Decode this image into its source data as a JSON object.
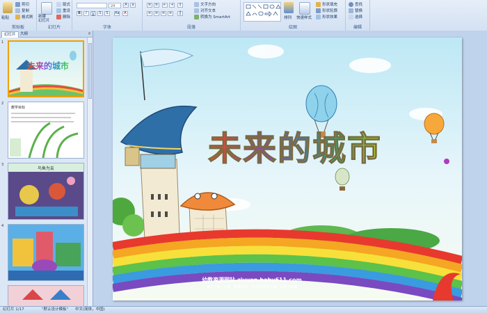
{
  "ribbon": {
    "groups": {
      "clipboard": "剪贴板",
      "slides": "幻灯片",
      "font": "字体",
      "paragraph": "段落",
      "drawing": "绘图",
      "editing": "编辑"
    },
    "paste": "粘贴",
    "cut": "剪切",
    "copy": "复制",
    "format_painter": "格式刷",
    "new_slide": "新建\n幻灯片",
    "layout": "版式",
    "reset": "重设",
    "delete": "删除",
    "font_size": "24",
    "text_direction": "文字方向",
    "align_text": "对齐文本",
    "convert_smartart": "转换为 SmartArt",
    "arrange": "排列",
    "quick_styles": "快速样式",
    "shape_fill": "形状填充",
    "shape_outline": "形状轮廓",
    "shape_effects": "形状效果",
    "find": "查找",
    "replace": "替换",
    "select": "选择"
  },
  "panel": {
    "tab_slides": "幻灯片",
    "tab_outline": "大纲",
    "close": "×",
    "thumbs": [
      {
        "num": "1",
        "title": "未来的城市"
      },
      {
        "num": "2",
        "title": "教学目标"
      },
      {
        "num": "3",
        "title": "鸟鱼为友"
      },
      {
        "num": "4",
        "title": ""
      }
    ]
  },
  "slide": {
    "title": "未来的城市",
    "footer_line1": "幼教资源网站  ziyuan.baby611.com",
    "footer_line2": "课件下载 · 儿歌 · 故事MP3 · FLASH课件下载 · 试卷下载等"
  },
  "status": {
    "slide_count": "幻灯片 1/17",
    "theme": "\"默认设计模板\"",
    "language": "中文(简体，中国)"
  },
  "colors": {
    "ribbon_bg": "#dbe6f4",
    "workspace_bg": "#c0d3ec",
    "selection": "#f0a000"
  }
}
